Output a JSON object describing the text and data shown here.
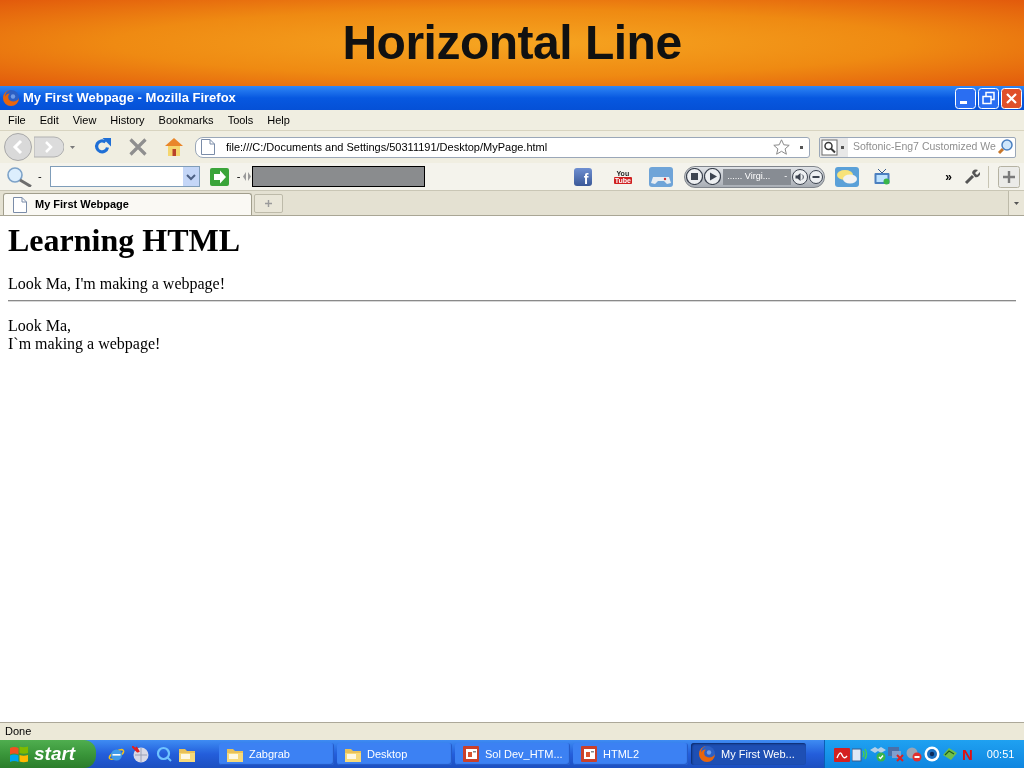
{
  "slide": {
    "title": "Horizontal Line"
  },
  "window": {
    "title": "My First Webpage - Mozilla Firefox"
  },
  "menu_bar": [
    "File",
    "Edit",
    "View",
    "History",
    "Bookmarks",
    "Tools",
    "Help"
  ],
  "navigation_toolbar": {
    "address": "file:///C:/Documents and Settings/50311191/Desktop/MyPage.html",
    "search": {
      "placeholder": "Softonic-Eng7 Customized We"
    }
  },
  "addon_toolbar": {
    "separator_marks": [
      "-",
      "-"
    ],
    "social_logo": "f",
    "video_logo": [
      "You",
      "Tube"
    ],
    "player": {
      "station": "...... Virgi...",
      "separator_mark": "-"
    },
    "overflow": "»"
  },
  "tabs": [
    {
      "label": "My First Webpage",
      "selected": true
    }
  ],
  "page": {
    "heading": "Learning HTML",
    "paragraph": "Look Ma, I'm making a webpage!",
    "horizontal_rule": true,
    "second_paragraph_lines": [
      "Look Ma,",
      "I`m making a webpage!"
    ]
  },
  "status_bar": "Done",
  "taskbar": {
    "start": "start",
    "tasks": [
      {
        "label": "Zabgrab",
        "kind": "folder",
        "selected": false
      },
      {
        "label": "Desktop",
        "kind": "folder",
        "selected": false
      },
      {
        "label": "Sol Dev_HTM...",
        "kind": "slides",
        "selected": false
      },
      {
        "label": "HTML2",
        "kind": "slides",
        "selected": false
      },
      {
        "label": "My First Web...",
        "kind": "browser",
        "selected": true
      }
    ],
    "tray": {
      "logo_letter": "N",
      "time": "00:51"
    }
  }
}
